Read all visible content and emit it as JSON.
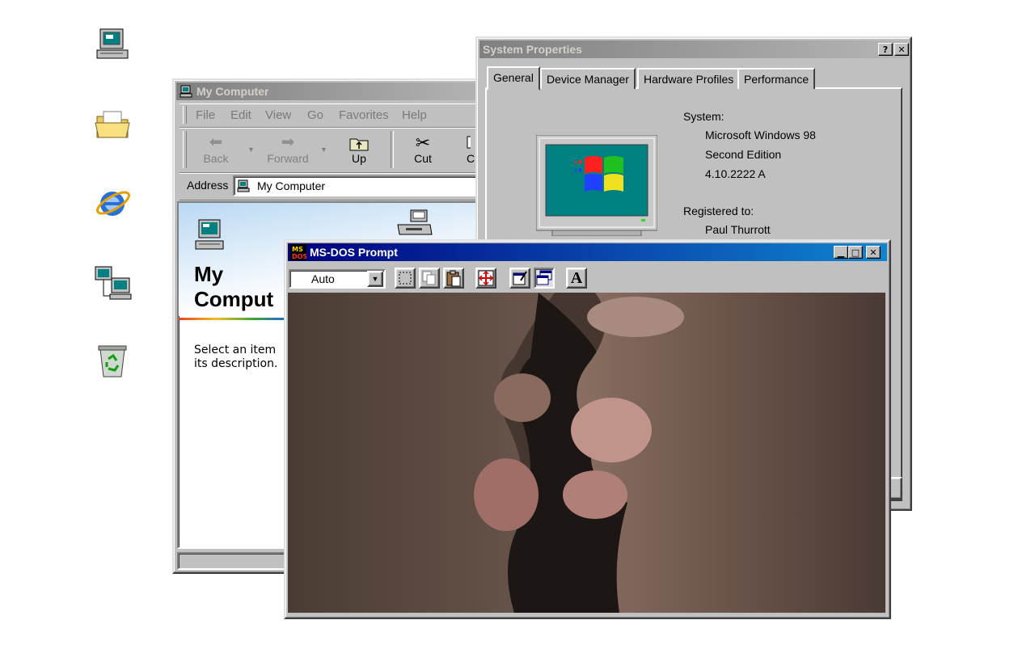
{
  "desktop": {
    "icons": [
      "my-computer-icon",
      "my-documents-icon",
      "internet-explorer-icon",
      "network-neighborhood-icon",
      "recycle-bin-icon"
    ]
  },
  "my_computer": {
    "title": "My Computer",
    "menu": [
      "File",
      "Edit",
      "View",
      "Go",
      "Favorites",
      "Help"
    ],
    "toolbar": {
      "back": "Back",
      "forward": "Forward",
      "up": "Up",
      "cut": "Cut",
      "copy_partial": "C"
    },
    "address_label": "Address",
    "address_value": "My Computer",
    "panel_title_line1": "My",
    "panel_title_line2": "Comput",
    "description_line1": "Select an item",
    "description_line2": "its description."
  },
  "system_properties": {
    "title": "System Properties",
    "help_button": "?",
    "close_button": "✕",
    "tabs": [
      "General",
      "Device Manager",
      "Hardware Profiles",
      "Performance"
    ],
    "system_label": "System:",
    "os_name": "Microsoft Windows 98",
    "edition": "Second Edition",
    "version": "4.10.2222 A",
    "registered_label": "Registered to:",
    "registered_user": "Paul Thurrott"
  },
  "dos_prompt": {
    "title": "MS-DOS Prompt",
    "font_select_value": "Auto",
    "icon_letters": "MS DOS"
  },
  "colors": {
    "window_gray": "#c0c0c0",
    "active_title": "#000080",
    "inactive_title": "#808080"
  }
}
